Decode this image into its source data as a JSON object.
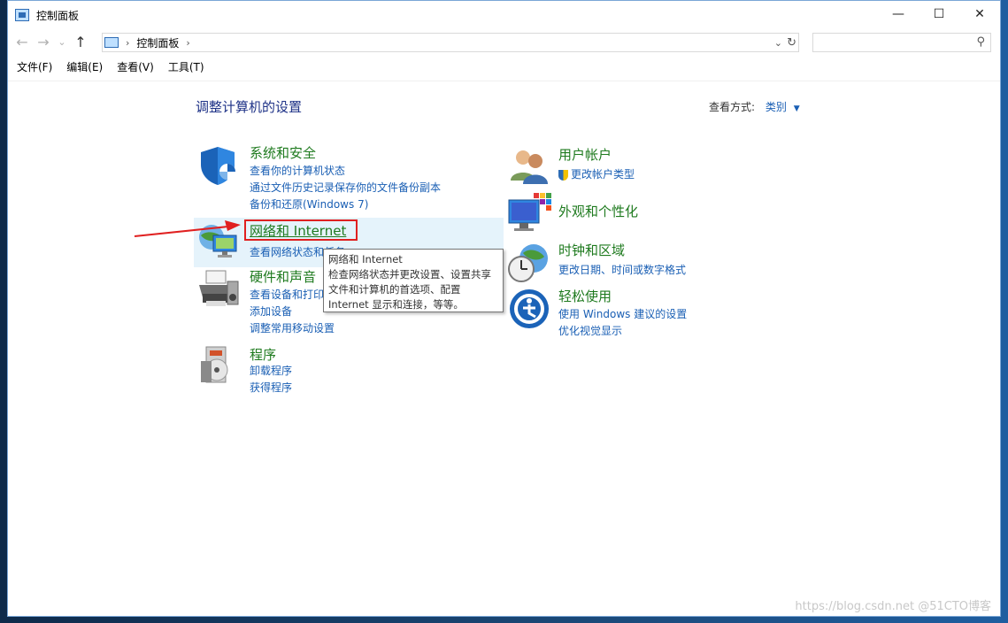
{
  "window": {
    "title": "控制面板"
  },
  "titlebar": {
    "minimize": "—",
    "maximize": "☐",
    "close": "✕"
  },
  "nav": {
    "back": "←",
    "forward": "→",
    "recent": "⌄",
    "up": "↑"
  },
  "address": {
    "path": "控制面板",
    "separator": "›",
    "dropdown": "⌄",
    "refresh": "↻"
  },
  "search": {
    "placeholder": "",
    "icon_glyph": "⚲"
  },
  "menu": [
    "文件(F)",
    "编辑(E)",
    "查看(V)",
    "工具(T)"
  ],
  "main": {
    "heading": "调整计算机的设置",
    "view_by_label": "查看方式:",
    "view_by_value": "类别",
    "view_by_caret": "▼"
  },
  "categories_left": [
    {
      "title": "系统和安全",
      "icon": "shield-icon",
      "links": [
        "查看你的计算机状态",
        "通过文件历史记录保存你的文件备份副本",
        "备份和还原(Windows 7)"
      ]
    },
    {
      "title": "网络和 Internet",
      "icon": "network-globe-icon",
      "links": [
        "查看网络状态和任务"
      ]
    },
    {
      "title": "硬件和声音",
      "icon": "printer-icon",
      "links": [
        "查看设备和打印机",
        "添加设备",
        "调整常用移动设置"
      ]
    },
    {
      "title": "程序",
      "icon": "programs-disc-icon",
      "links": [
        "卸载程序",
        "获得程序"
      ]
    }
  ],
  "categories_right": [
    {
      "title": "用户帐户",
      "icon": "users-icon",
      "links": [
        "更改帐户类型"
      ]
    },
    {
      "title": "外观和个性化",
      "icon": "monitor-palette-icon",
      "links": []
    },
    {
      "title": "时钟和区域",
      "icon": "clock-globe-icon",
      "links": [
        "更改日期、时间或数字格式"
      ]
    },
    {
      "title": "轻松使用",
      "icon": "ease-of-access-icon",
      "links": [
        "使用 Windows 建议的设置",
        "优化视觉显示"
      ]
    }
  ],
  "tooltip": {
    "line1": "网络和 Internet",
    "line2": "检查网络状态并更改设置、设置共享",
    "line3": "文件和计算机的首选项、配置",
    "line4": "Internet 显示和连接，等等。"
  },
  "watermark": "https://blog.csdn.net @51CTO博客",
  "colors": {
    "category_title": "#1e7a1e",
    "link": "#1a5fb4",
    "heading": "#1e3287",
    "annotation": "#e02020"
  }
}
